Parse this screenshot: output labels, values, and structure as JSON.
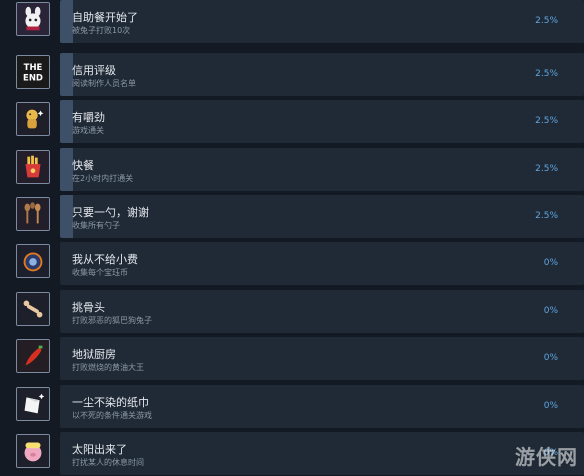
{
  "achievements": [
    {
      "title": "自助餐开始了",
      "desc": "被兔子打败10次",
      "pct": "2.5%",
      "progress": 0.025,
      "icon": "white-bunny-icon"
    },
    {
      "title": "信用评级",
      "desc": "阅读制作人员名单",
      "pct": "2.5%",
      "progress": 0.025,
      "icon": "the-end-icon"
    },
    {
      "title": "有嚼劲",
      "desc": "游戏通关",
      "pct": "2.5%",
      "progress": 0.025,
      "icon": "golden-chick-icon"
    },
    {
      "title": "快餐",
      "desc": "在2小时内打通关",
      "pct": "2.5%",
      "progress": 0.025,
      "icon": "fries-icon"
    },
    {
      "title": "只要一勺，谢谢",
      "desc": "收集所有勺子",
      "pct": "2.5%",
      "progress": 0.025,
      "icon": "spoons-icon"
    },
    {
      "title": "我从不给小费",
      "desc": "收集每个宝珏币",
      "pct": "0%",
      "progress": 0,
      "icon": "coin-icon"
    },
    {
      "title": "挑骨头",
      "desc": "打败邪恶的狐巴狗兔子",
      "pct": "0%",
      "progress": 0,
      "icon": "bone-icon"
    },
    {
      "title": "地狱厨房",
      "desc": "打败燃烧的黄油大王",
      "pct": "0%",
      "progress": 0,
      "icon": "chili-icon"
    },
    {
      "title": "一尘不染的纸巾",
      "desc": "以不死的条件通关游戏",
      "pct": "0%",
      "progress": 0,
      "icon": "napkin-icon"
    },
    {
      "title": "太阳出来了",
      "desc": "打扰某人的休息时间",
      "pct": "0%",
      "progress": 0,
      "icon": "sleeping-pig-icon"
    }
  ],
  "watermark": "游侠网",
  "colors": {
    "percent": "#5fa5e0",
    "bar_bg": "#1f2a36",
    "bar_fill": "#3d5068",
    "page_bg": "#141a23"
  }
}
